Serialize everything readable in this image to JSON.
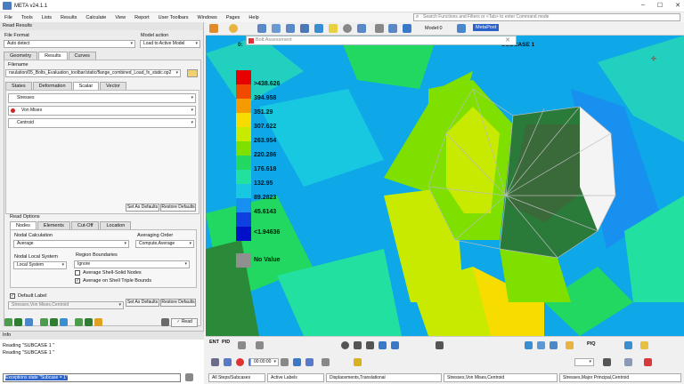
{
  "window": {
    "title": "META v24.1.1"
  },
  "menu": [
    "File",
    "Tools",
    "Lists",
    "Results",
    "Calculate",
    "View",
    "Report",
    "User Toolbars",
    "Windows",
    "Pages",
    "Help"
  ],
  "search": {
    "placeholder": "Search Functions and Filters or <Tab> to enter Command mode"
  },
  "panel": {
    "title": "Read Results",
    "file_format_label": "File Format",
    "file_format_value": "Auto detect",
    "model_action_label": "Model action",
    "model_action_value": "Load to Active Model",
    "tabs": [
      "Geometry",
      "Results",
      "Curves"
    ],
    "filename_label": "Filename",
    "filename_value": "nsulation/05_Bolts_Evaluation_toolbar/static/flange_combined_Load_fx_static.op2",
    "subtabs": [
      "States",
      "Deformation",
      "Scalar",
      "Vector"
    ],
    "scalar_rows": [
      "Stresses",
      "Von Mises",
      "Centroid"
    ],
    "set_defaults": "Set As Defaults",
    "restore_defaults": "Restore Defaults",
    "read_options_label": "Read Options",
    "read_tabs": [
      "Nodes",
      "Elements",
      "Cut-Off",
      "Location"
    ],
    "nodal_calc_label": "Nodal Calculation",
    "nodal_calc_value": "Average",
    "averaging_order_label": "Averaging Order",
    "averaging_order_value": "Compute,Average",
    "nodal_local_label": "Nodal Local System",
    "nodal_local_value": "Local System",
    "region_label": "Region Boundaries",
    "region_value": "Ignore",
    "avg_shell_solid": "Average Shell-Solid Nodes",
    "avg_shell_triple": "Average on Shell Triple Bounds",
    "default_label_label": "Default Label",
    "default_label_value": "Stresses,Von Mises,Centroid",
    "set_defaults2": "Set As Defaults",
    "restore_defaults2": "Restore Defaults",
    "read_button": "Read"
  },
  "toolbar": {
    "model_label": "Model:0",
    "active_tag": "MetaPost"
  },
  "viewport": {
    "subcase_label": "SUBCASE 1",
    "left_label": "0:",
    "dialog_title": "Bolt Assessment"
  },
  "legend": {
    "levels": [
      ">438.626",
      "394.958",
      "351.29",
      "307.622",
      "263.954",
      "220.286",
      "176.618",
      "132.95",
      "89.2823",
      "45.6143",
      "<1.94636"
    ],
    "colors": [
      "#e60000",
      "#f04a00",
      "#f59a00",
      "#f7dc00",
      "#c8ea00",
      "#7fe000",
      "#22d860",
      "#22e0a0",
      "#18c8e0",
      "#1890f0",
      "#1040e0",
      "#0010c8"
    ],
    "no_value": "No Value",
    "no_value_color": "#909090"
  },
  "info": {
    "title": "Info",
    "lines": [
      "Reading \"SUBCASE 1      \"",
      "Reading \"SUBCASE 1      \""
    ],
    "command": "Exceptions state \"Subcase = 1\""
  },
  "bottom": {
    "time_value": "00:00:00",
    "ent_label": "ENT",
    "pid_label": "PID",
    "piq_label": "PIQ",
    "status_items": [
      "All Steps/Subcases",
      "Active Labels",
      "Displacements,Translational",
      "Stresses,Von Mises,Centroid",
      "Stresses,Major Principal,Centroid"
    ]
  }
}
